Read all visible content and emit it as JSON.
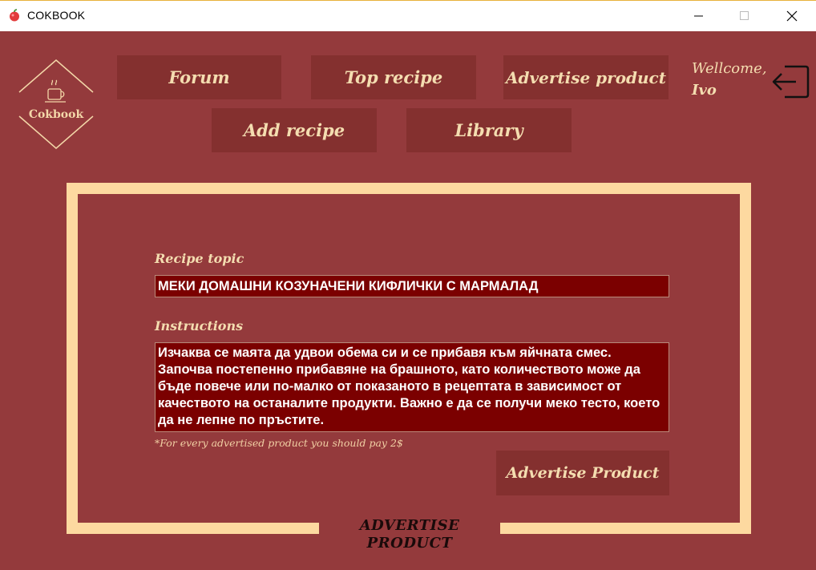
{
  "window": {
    "title": "COKBOOK",
    "icon": "apple-icon",
    "controls": [
      "minimize-icon",
      "maximize-icon",
      "close-icon"
    ]
  },
  "logo": {
    "text": "Cokbook",
    "icon": "coffee-cup-icon"
  },
  "nav": {
    "forum": "Forum",
    "top_recipe": "Top recipe",
    "advertise_product": "Advertise product",
    "add_recipe": "Add recipe",
    "library": "Library"
  },
  "user": {
    "greeting": "Wellcome,",
    "name": "Ivo",
    "logout_icon": "logout-icon"
  },
  "form": {
    "topic_label": "Recipe topic",
    "topic_value": "МЕКИ ДОМАШНИ КОЗУНАЧЕНИ КИФЛИЧКИ С МАРМАЛАД",
    "instructions_label": "Instructions",
    "instructions_value": "Изчаква се маята да удвои обема си и се прибавя към яйчната смес. Започва постепенно прибавяне на брашното, като количеството може да бъде повече или по-малко от показаното в рецептата в зависимост от качеството на останалите продукти. Важно е да се получи меко тесто, което да не лепне по пръстите.",
    "note": "*For every advertised product you should pay 2$",
    "submit_label": "Advertise Product",
    "section_caption": "ADVERTISE PRODUCT"
  },
  "colors": {
    "background": "#943a3c",
    "button": "#84302f",
    "accent": "#fdd9a0",
    "field": "#7b0000",
    "text": "#f4ddb0"
  }
}
